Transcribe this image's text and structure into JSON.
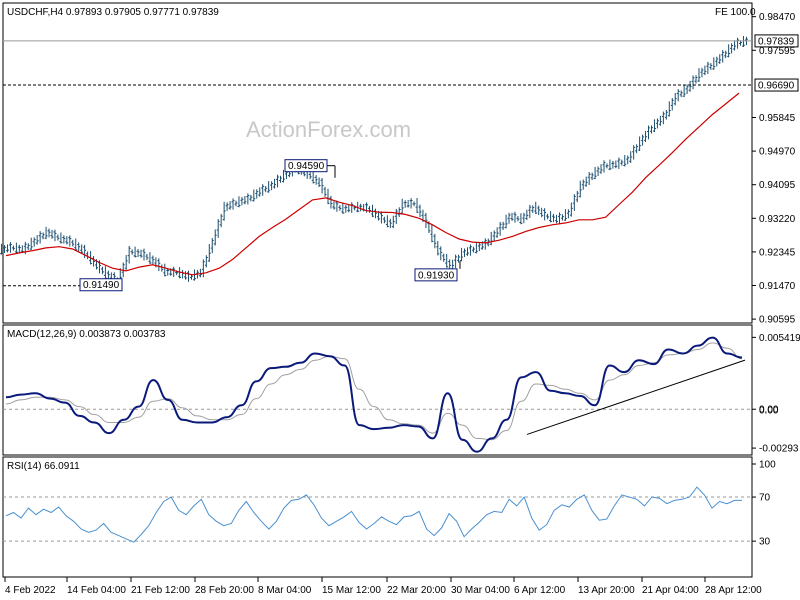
{
  "header": {
    "symbol_line": "USDCHF,H4  0.97893 0.97905 0.97771 0.97839",
    "fe_label": "FE 100.0",
    "watermark": "ActionForex.com"
  },
  "chart_data": [
    {
      "type": "candlestick",
      "title": "USDCHF,H4",
      "ohlc_last": {
        "open": 0.97893,
        "high": 0.97905,
        "low": 0.97771,
        "close": 0.97839
      },
      "ylim": [
        0.9052,
        0.988
      ],
      "y_ticks": [
        "0.98470",
        "0.97595",
        "0.96690",
        "0.95845",
        "0.94970",
        "0.94095",
        "0.93220",
        "0.92345",
        "0.91470",
        "0.90595"
      ],
      "horizontal_lines": [
        {
          "value": 0.97839,
          "label": "0.97839",
          "style": "solid"
        },
        {
          "value": 0.9669,
          "label": "0.96690",
          "style": "dashed"
        }
      ],
      "annotations": [
        {
          "label": "0.94590",
          "value": 0.9459,
          "x": "15 Mar 2022"
        },
        {
          "label": "0.91930",
          "value": 0.9193,
          "x": "31 Mar 2022"
        },
        {
          "label": "0.91490",
          "value": 0.9149,
          "x": "21 Feb 2022"
        }
      ],
      "series": [
        {
          "name": "close",
          "values": [
            0.9245,
            0.924,
            0.9262,
            0.9285,
            0.927,
            0.926,
            0.9238,
            0.9205,
            0.9175,
            0.9158,
            0.9235,
            0.9228,
            0.921,
            0.9182,
            0.918,
            0.9168,
            0.918,
            0.926,
            0.935,
            0.9362,
            0.9372,
            0.9392,
            0.9408,
            0.9433,
            0.9452,
            0.9436,
            0.9412,
            0.9356,
            0.9345,
            0.935,
            0.9348,
            0.9325,
            0.9305,
            0.9358,
            0.936,
            0.9308,
            0.9234,
            0.9195,
            0.923,
            0.9242,
            0.9255,
            0.9288,
            0.9326,
            0.9318,
            0.935,
            0.9328,
            0.9318,
            0.9335,
            0.9405,
            0.9435,
            0.9458,
            0.9462,
            0.9475,
            0.952,
            0.9558,
            0.9585,
            0.9638,
            0.966,
            0.9698,
            0.972,
            0.9745,
            0.9775,
            0.9784
          ]
        },
        {
          "name": "moving average",
          "values": [
            0.9225,
            0.9232,
            0.9238,
            0.9245,
            0.9248,
            0.9242,
            0.9225,
            0.9207,
            0.9192,
            0.9185,
            0.9195,
            0.9201,
            0.9192,
            0.9182,
            0.9175,
            0.918,
            0.9192,
            0.9215,
            0.9245,
            0.9275,
            0.9298,
            0.932,
            0.9345,
            0.937,
            0.9375,
            0.9364,
            0.9355,
            0.9342,
            0.9338,
            0.9337,
            0.9332,
            0.9322,
            0.9305,
            0.9285,
            0.9268,
            0.926,
            0.9258,
            0.9265,
            0.9275,
            0.9288,
            0.9298,
            0.9305,
            0.931,
            0.9318,
            0.9318,
            0.9325,
            0.9358,
            0.939,
            0.9428,
            0.946,
            0.9493,
            0.9528,
            0.956,
            0.9592,
            0.962,
            0.9648
          ]
        }
      ]
    },
    {
      "type": "line",
      "title": "MACD(12,26,9) 0.003873 0.003783",
      "ylim": [
        -0.0033,
        0.0062
      ],
      "y_ticks": [
        "0.005419",
        "0.00",
        "0.00",
        "-0.00293"
      ],
      "series": [
        {
          "name": "MACD",
          "values": [
            0.0009,
            0.0011,
            0.0012,
            0.0008,
            0.0005,
            -0.0005,
            -0.001,
            -0.0018,
            -0.0008,
            0.0002,
            0.0022,
            0.0007,
            -0.0008,
            -0.001,
            -0.001,
            -0.0006,
            0.0003,
            0.0021,
            0.0031,
            0.0032,
            0.0035,
            0.0042,
            0.004,
            0.0033,
            -0.0012,
            -0.0015,
            -0.0014,
            -0.0012,
            -0.0013,
            -0.0022,
            0.0012,
            -0.0023,
            -0.0032,
            -0.0022,
            -0.0008,
            0.0024,
            0.0028,
            0.0014,
            0.0012,
            0.001,
            0.0003,
            0.0033,
            0.0028,
            0.0037,
            0.0034,
            0.0045,
            0.0042,
            0.0048,
            0.0054,
            0.0042,
            0.0039
          ]
        },
        {
          "name": "Signal",
          "values": [
            0.0004,
            0.0007,
            0.0009,
            0.0009,
            0.0007,
            0.0002,
            -0.0004,
            -0.001,
            -0.001,
            -0.0006,
            0.0006,
            0.0008,
            0.0001,
            -0.0005,
            -0.0008,
            -0.0008,
            -0.0004,
            0.0008,
            0.0019,
            0.0026,
            0.003,
            0.0037,
            0.004,
            0.0038,
            0.0015,
            0.0002,
            -0.0008,
            -0.0011,
            -0.0012,
            -0.0018,
            -0.0003,
            -0.0012,
            -0.0022,
            -0.0023,
            -0.0016,
            0.0006,
            0.0019,
            0.0018,
            0.0015,
            0.0012,
            0.0007,
            0.0022,
            0.0026,
            0.0033,
            0.0035,
            0.0041,
            0.0042,
            0.0045,
            0.005,
            0.0046,
            0.0038
          ]
        }
      ],
      "trendline": [
        {
          "x": "6 Apr 2022",
          "value": -0.0019
        },
        {
          "x": "28 Apr 2022 12:00",
          "value": 0.0037
        }
      ]
    },
    {
      "type": "line",
      "title": "RSI(14) 66.0911",
      "ylim": [
        0,
        100
      ],
      "y_ticks": [
        "100",
        "70",
        "30"
      ],
      "levels": [
        70,
        30
      ],
      "series": [
        {
          "name": "RSI",
          "values": [
            53,
            56,
            51,
            60,
            54,
            59,
            56,
            61,
            53,
            48,
            41,
            38,
            40,
            46,
            38,
            35,
            32,
            29,
            36,
            44,
            56,
            66,
            70,
            58,
            54,
            62,
            68,
            54,
            48,
            44,
            46,
            58,
            66,
            56,
            48,
            41,
            48,
            60,
            67,
            68,
            72,
            63,
            51,
            44,
            48,
            52,
            57,
            47,
            41,
            46,
            52,
            48,
            45,
            52,
            53,
            57,
            41,
            35,
            42,
            55,
            48,
            34,
            41,
            47,
            54,
            57,
            56,
            68,
            62,
            70,
            51,
            40,
            45,
            58,
            63,
            61,
            68,
            72,
            58,
            49,
            50,
            62,
            72,
            70,
            68,
            62,
            70,
            69,
            64,
            67,
            68,
            70,
            79,
            72,
            60,
            66,
            64,
            67,
            67
          ]
        }
      ]
    }
  ],
  "x_axis": {
    "tick_labels": [
      "4 Feb 2022",
      "14 Feb 04:00",
      "21 Feb 12:00",
      "28 Feb 20:00",
      "8 Mar 04:00",
      "15 Mar 12:00",
      "22 Mar 20:00",
      "30 Mar 04:00",
      "6 Apr 12:00",
      "13 Apr 20:00",
      "21 Apr 04:00",
      "28 Apr 12:00"
    ]
  },
  "colors": {
    "candles": "#1a4d6e",
    "moving_average": "#cc0000",
    "macd": "#0a1a7a",
    "signal": "#a0a0a0",
    "rsi": "#4a90d0",
    "trendline": "#000000",
    "annotation_box": "#0a1a7a",
    "price_box": "#000000"
  }
}
